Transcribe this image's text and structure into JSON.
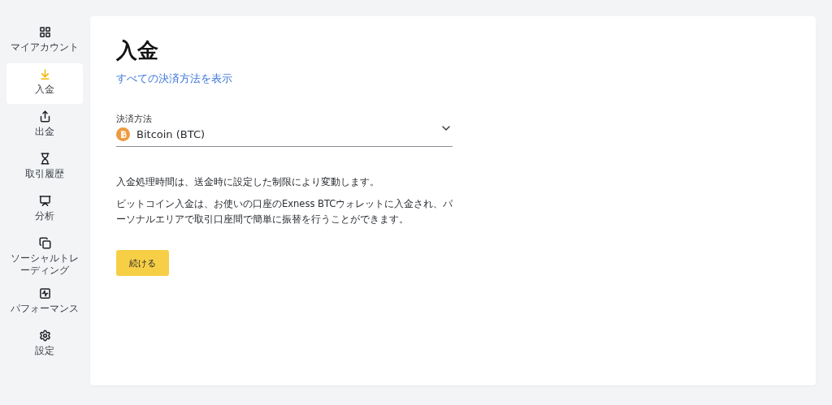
{
  "sidebar": {
    "items": [
      {
        "label": "マイアカウント",
        "kind": "grid",
        "selected": false
      },
      {
        "label": "入金",
        "kind": "download",
        "selected": true
      },
      {
        "label": "出金",
        "kind": "upload",
        "selected": false
      },
      {
        "label": "取引履歴",
        "kind": "hourglass",
        "selected": false
      },
      {
        "label": "分析",
        "kind": "chart",
        "selected": false
      },
      {
        "label": "ソーシャルトレーディング",
        "kind": "copy",
        "selected": false
      },
      {
        "label": "パフォーマンス",
        "kind": "activity",
        "selected": false
      },
      {
        "label": "設定",
        "kind": "gear",
        "selected": false
      }
    ]
  },
  "main": {
    "title": "入金",
    "link": "すべての決済方法を表示",
    "payment_method": {
      "label": "決済方法",
      "value": "Bitcoin (BTC)"
    },
    "paragraphs": [
      "入金処理時間は、送金時に設定した制限により変動します。",
      "ビットコイン入金は、お使いの口座のExness BTCウォレットに入金され、パーソナルエリアで取引口座間で簡単に振替を行うことができます。"
    ],
    "button": "続ける"
  }
}
